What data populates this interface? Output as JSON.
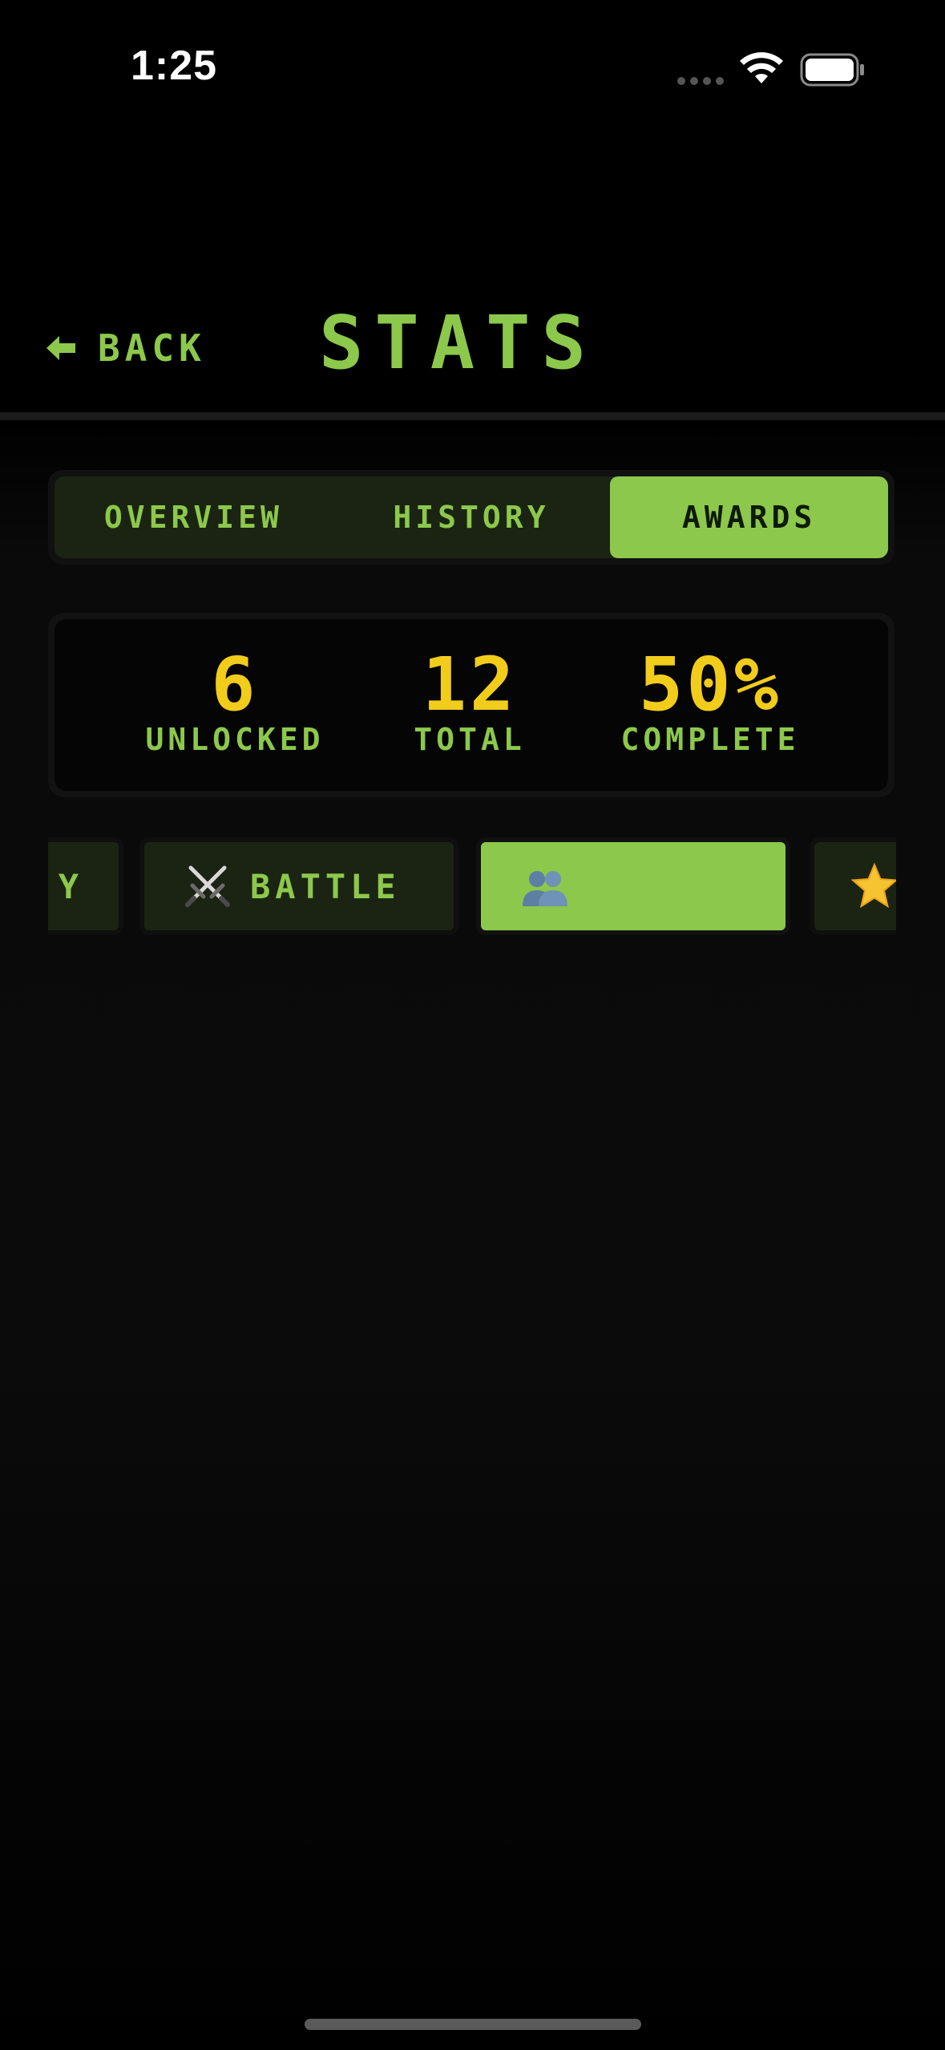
{
  "status_bar": {
    "time": "1:25"
  },
  "header": {
    "back_label": "BACK",
    "title": "STATS"
  },
  "tabs": [
    {
      "label": "OVERVIEW",
      "active": false
    },
    {
      "label": "HISTORY",
      "active": false
    },
    {
      "label": "AWARDS",
      "active": true
    }
  ],
  "summary": {
    "unlocked": {
      "value": "6",
      "label": "UNLOCKED"
    },
    "total": {
      "value": "12",
      "label": "TOTAL"
    },
    "complete": {
      "value": "50%",
      "label": "COMPLETE"
    }
  },
  "categories": [
    {
      "label": "Y",
      "icon": "none",
      "selected": false
    },
    {
      "label": "BATTLE",
      "icon": "crossed-swords-icon",
      "selected": false
    },
    {
      "label": "",
      "icon": "people-icon",
      "selected": true
    },
    {
      "label": "",
      "icon": "star-icon",
      "selected": false
    }
  ],
  "colors": {
    "accent": "#8cc84b",
    "value": "#f2cc1b",
    "background": "#000000"
  }
}
